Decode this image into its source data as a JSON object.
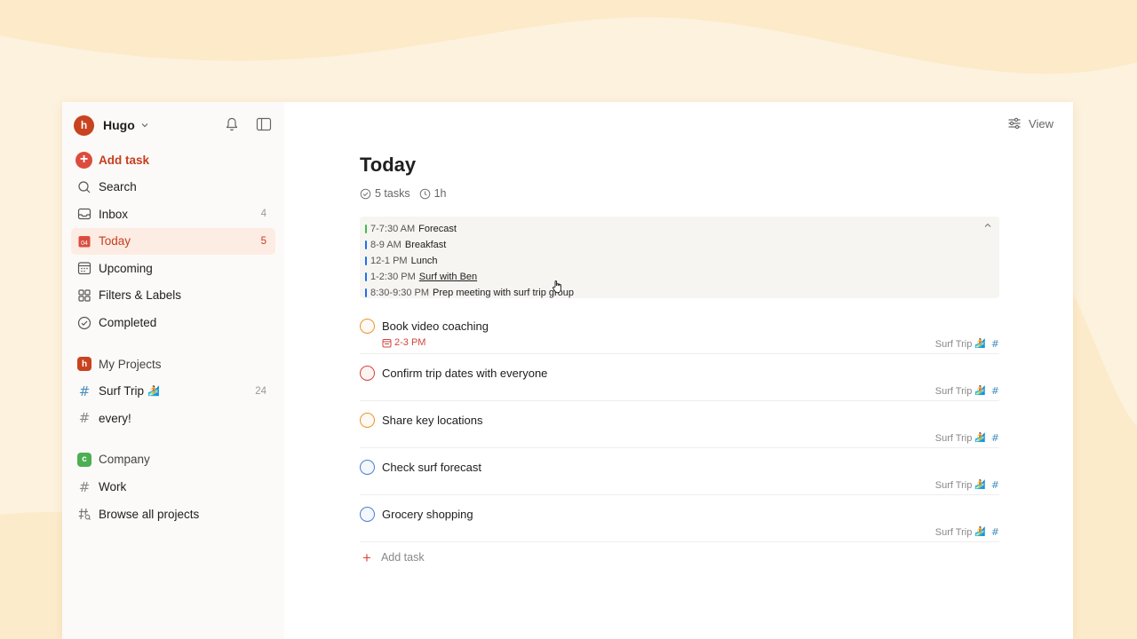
{
  "user": {
    "initial": "h",
    "name": "Hugo"
  },
  "sidebar": {
    "add_task": "Add task",
    "nav": [
      {
        "label": "Search",
        "count": ""
      },
      {
        "label": "Inbox",
        "count": "4"
      },
      {
        "label": "Today",
        "count": "5",
        "icon_text": "04"
      },
      {
        "label": "Upcoming",
        "count": ""
      },
      {
        "label": "Filters & Labels",
        "count": ""
      },
      {
        "label": "Completed",
        "count": ""
      }
    ],
    "my_projects": {
      "badge": "h",
      "label": "My Projects",
      "items": [
        {
          "label": "Surf Trip",
          "emoji": "🏄",
          "count": "24"
        },
        {
          "label": "every!",
          "count": ""
        }
      ]
    },
    "company": {
      "badge": "c",
      "label": "Company",
      "items": [
        {
          "label": "Work"
        },
        {
          "label": "Browse all projects"
        }
      ]
    }
  },
  "header": {
    "view_label": "View"
  },
  "page": {
    "title": "Today",
    "tasks_count": "5 tasks",
    "duration": "1h"
  },
  "schedule": [
    {
      "time": "7-7:30 AM",
      "title": "Forecast",
      "color": "#3fb950"
    },
    {
      "time": "8-9 AM",
      "title": "Breakfast",
      "color": "#1f6feb"
    },
    {
      "time": "12-1 PM",
      "title": "Lunch",
      "color": "#1f6feb"
    },
    {
      "time": "1-2:30 PM",
      "title": "Surf with Ben",
      "color": "#1f6feb"
    },
    {
      "time": "8:30-9:30 PM",
      "title": "Prep meeting with surf trip group",
      "color": "#1f6feb"
    }
  ],
  "tasks": [
    {
      "name": "Book video coaching",
      "due": "2-3 PM",
      "project": "Surf Trip",
      "emoji": "🏄",
      "priority_color": "#e8962e"
    },
    {
      "name": "Confirm trip dates with everyone",
      "due": "",
      "project": "Surf Trip",
      "emoji": "🏄",
      "priority_color": "#d1453b"
    },
    {
      "name": "Share key locations",
      "due": "",
      "project": "Surf Trip",
      "emoji": "🏄",
      "priority_color": "#e8962e"
    },
    {
      "name": "Check surf forecast",
      "due": "",
      "project": "Surf Trip",
      "emoji": "🏄",
      "priority_color": "#4a7fd0"
    },
    {
      "name": "Grocery shopping",
      "due": "",
      "project": "Surf Trip",
      "emoji": "🏄",
      "priority_color": "#4a7fd0"
    }
  ],
  "add_task_main": "Add task",
  "colors": {
    "accent": "#dc4c3e",
    "active_bg": "#fdece3",
    "sidebar_bg": "#fcfaf8"
  }
}
